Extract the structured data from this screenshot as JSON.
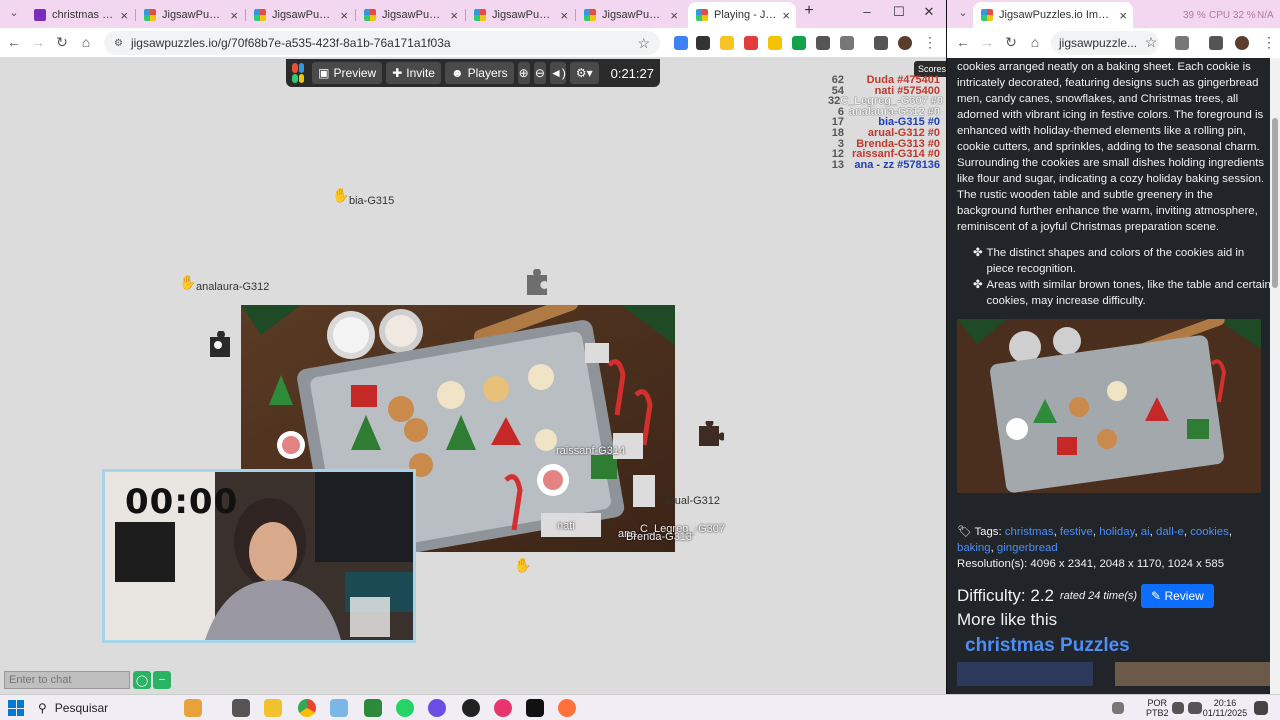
{
  "left_window": {
    "tabs": [
      {
        "label": "christmas Images",
        "color": "#7b2cbf"
      },
      {
        "label": "JigsawPuzzles.io",
        "color": "#e44d8a"
      },
      {
        "label": "JigsawPuzzles.io",
        "color": "#e44d8a"
      },
      {
        "label": "JigsawPuzzles.io",
        "color": "#e44d8a"
      },
      {
        "label": "JigsawPuzzles.io",
        "color": "#e44d8a"
      },
      {
        "label": "JigsawPuzzles.io",
        "color": "#e44d8a"
      },
      {
        "label": "Playing - JigsawP",
        "color": "#e44d8a",
        "active": true
      }
    ],
    "url": "jigsawpuzzles.io/g/70f68b7e-a535-423f-8a1b-76a171a1f03a"
  },
  "puzzle": {
    "toolbar": {
      "preview": "Preview",
      "invite": "Invite",
      "players": "Players",
      "timer": "0:21:27"
    },
    "scores_label": "Scores",
    "scores": [
      {
        "count": "62",
        "name": "Duda #475401",
        "color": "#c0392b"
      },
      {
        "count": "54",
        "name": "nati #575400",
        "color": "#c0392b"
      },
      {
        "count": "32",
        "name": "C_Legreg_-G307 #0",
        "color": "#eeeeee"
      },
      {
        "count": "6",
        "name": "analaura-G312 #0",
        "color": "#eeeeee"
      },
      {
        "count": "17",
        "name": "bia-G315 #0",
        "color": "#1f3fb5"
      },
      {
        "count": "18",
        "name": "arual-G312 #0",
        "color": "#c0392b"
      },
      {
        "count": "3",
        "name": "Brenda-G313 #0",
        "color": "#c0392b"
      },
      {
        "count": "12",
        "name": "raissanf-G314 #0",
        "color": "#c0392b"
      },
      {
        "count": "13",
        "name": "ana - zz #578136",
        "color": "#1f3fb5"
      }
    ],
    "players_on_board": {
      "bia": "bia-G315",
      "analaura": "analaura-G312",
      "raissanf": "raissanf-G314",
      "arual": "arual-G312",
      "nati": "nati",
      "legreg": "C_Legreg_-G307",
      "ana": "ana",
      "brenda": "Brenda-G313"
    },
    "webcam_time": "00:00",
    "chat_placeholder": "Enter to chat"
  },
  "right_window": {
    "tab_label": "JigsawPuzzles.io Image - Festive",
    "url": "jigsawpuzzle...",
    "overlay": {
      "ram": "39 %",
      "cpu": "CPU 32 %",
      "gpu": "N/A"
    },
    "description": "cookies arranged neatly on a baking sheet. Each cookie is intricately decorated, featuring designs such as gingerbread men, candy canes, snowflakes, and Christmas trees, all adorned with vibrant icing in festive colors. The foreground is enhanced with holiday-themed elements like a rolling pin, cookie cutters, and sprinkles, adding to the seasonal charm. Surrounding the cookies are small dishes holding ingredients like flour and sugar, indicating a cozy holiday baking session. The rustic wooden table and subtle greenery in the background further enhance the warm, inviting atmosphere, reminiscent of a joyful Christmas preparation scene.",
    "bullets": [
      "The distinct shapes and colors of the cookies aid in piece recognition.",
      "Areas with similar brown tones, like the table and certain cookies, may increase difficulty."
    ],
    "tags_label": "Tags:",
    "tags": [
      "christmas",
      "festive",
      "holiday",
      "ai",
      "dall-e",
      "cookies",
      "baking",
      "gingerbread"
    ],
    "resolutions": "Resolution(s): 4096 x 2341, 2048 x 1170, 1024 x 585",
    "difficulty": "Difficulty: 2.2",
    "rated": "rated 24 time(s)",
    "review": "Review",
    "more_like": "More like this",
    "xmas_link": "christmas Puzzles"
  },
  "taskbar": {
    "search": "Pesquisar",
    "lang": "POR",
    "lang2": "PTB2",
    "time": "20:16",
    "date": "01/11/2025"
  }
}
